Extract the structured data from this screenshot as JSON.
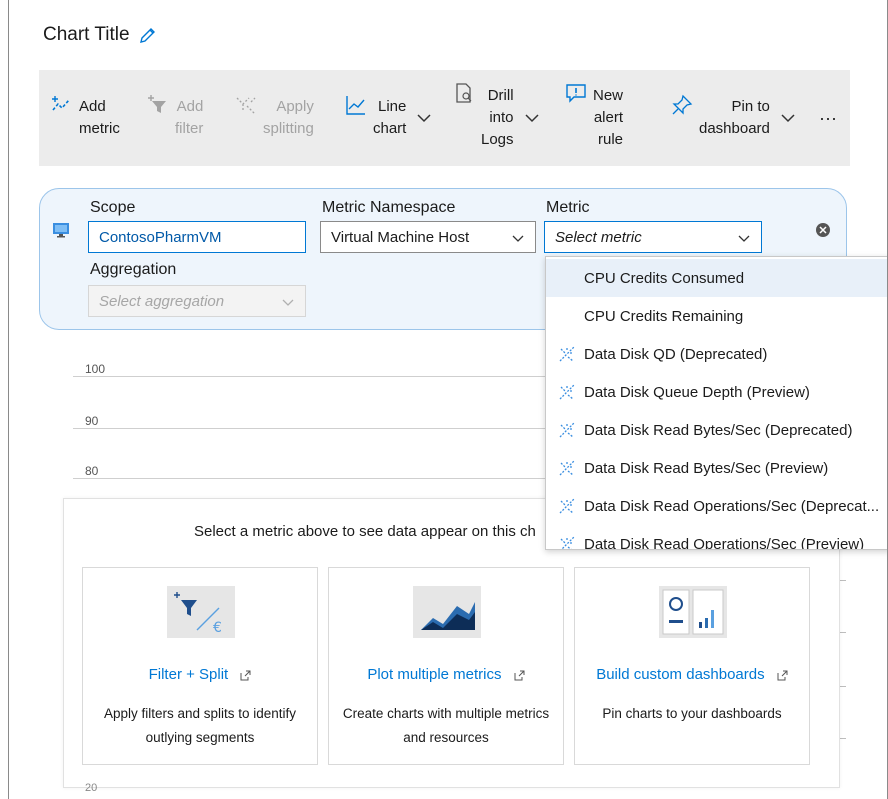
{
  "chart": {
    "title": "Chart Title"
  },
  "toolbar": {
    "add_metric": [
      "Add",
      "metric"
    ],
    "add_filter": [
      "Add",
      "filter"
    ],
    "apply_splitting": [
      "Apply",
      "splitting"
    ],
    "line_chart": [
      "Line",
      "chart"
    ],
    "drill_into_logs": [
      "Drill",
      "into",
      "Logs"
    ],
    "new_alert_rule": [
      "New",
      "alert",
      "rule"
    ],
    "pin_to_dashboard": [
      "Pin to",
      "dashboard"
    ],
    "more": "···"
  },
  "scope": {
    "scope_label": "Scope",
    "scope_value": "ContosoPharmVM",
    "namespace_label": "Metric Namespace",
    "namespace_value": "Virtual Machine Host",
    "metric_label": "Metric",
    "metric_placeholder": "Select metric",
    "aggregation_label": "Aggregation",
    "aggregation_placeholder": "Select aggregation"
  },
  "axis_ticks": [
    "100",
    "90",
    "80"
  ],
  "bottom_tick": "20",
  "metric_options": [
    {
      "label": "CPU Credits Consumed",
      "icon": ""
    },
    {
      "label": "CPU Credits Remaining",
      "icon": ""
    },
    {
      "label": "Data Disk QD (Deprecated)",
      "icon": "sparkle-icon"
    },
    {
      "label": "Data Disk Queue Depth (Preview)",
      "icon": "sparkle-icon"
    },
    {
      "label": "Data Disk Read Bytes/Sec (Deprecated)",
      "icon": "sparkle-icon"
    },
    {
      "label": "Data Disk Read Bytes/Sec (Preview)",
      "icon": "sparkle-icon"
    },
    {
      "label": "Data Disk Read Operations/Sec (Deprecat...",
      "icon": "sparkle-icon"
    },
    {
      "label": "Data Disk Read Operations/Sec (Preview)",
      "icon": "sparkle-icon"
    }
  ],
  "empty_state": {
    "message": "Select a metric above to see data appear on this ch",
    "tiles": [
      {
        "title": "Filter + Split",
        "desc": [
          "Apply filters and splits to identify",
          "outlying segments"
        ]
      },
      {
        "title": "Plot multiple metrics",
        "desc": [
          "Create charts with multiple metrics",
          "and resources"
        ]
      },
      {
        "title": "Build custom dashboards",
        "desc": [
          "Pin charts to your dashboards"
        ]
      }
    ]
  },
  "colors": {
    "accent": "#0078d4",
    "panel_bg": "#eef5fc",
    "panel_border": "#9cc5ea",
    "toolbar_bg": "#ececec"
  }
}
